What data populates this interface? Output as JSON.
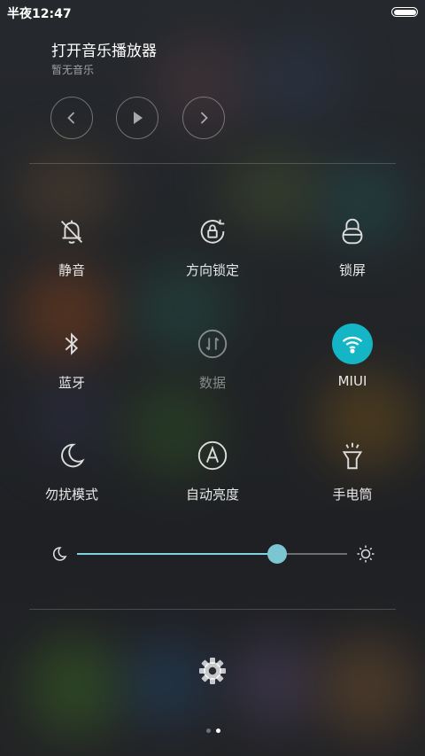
{
  "status_bar": {
    "time": "半夜12:47",
    "battery_level": 1.0
  },
  "music": {
    "title": "打开音乐播放器",
    "subtitle": "暂无音乐",
    "controls": [
      "chevron-left-icon",
      "play-icon",
      "chevron-right-icon"
    ]
  },
  "toggles": [
    {
      "label": "静音",
      "icon": "mute-bell-icon",
      "state": "off"
    },
    {
      "label": "方向锁定",
      "icon": "rotation-lock-icon",
      "state": "off"
    },
    {
      "label": "锁屏",
      "icon": "lock-icon",
      "state": "off"
    },
    {
      "label": "蓝牙",
      "icon": "bluetooth-icon",
      "state": "off"
    },
    {
      "label": "数据",
      "icon": "mobile-data-icon",
      "state": "disabled"
    },
    {
      "label": "MIUI",
      "icon": "wifi-icon",
      "state": "on"
    },
    {
      "label": "勿扰模式",
      "icon": "moon-icon",
      "state": "off"
    },
    {
      "label": "自动亮度",
      "icon": "auto-brightness-icon",
      "state": "off"
    },
    {
      "label": "手电筒",
      "icon": "flashlight-icon",
      "state": "off"
    }
  ],
  "brightness": {
    "level": 0.74
  },
  "pager": {
    "count": 2,
    "active": 1
  },
  "colors": {
    "accent": "#14b6c6",
    "slider_fill": "#7fd3df",
    "thumb": "#7cc6d4"
  }
}
